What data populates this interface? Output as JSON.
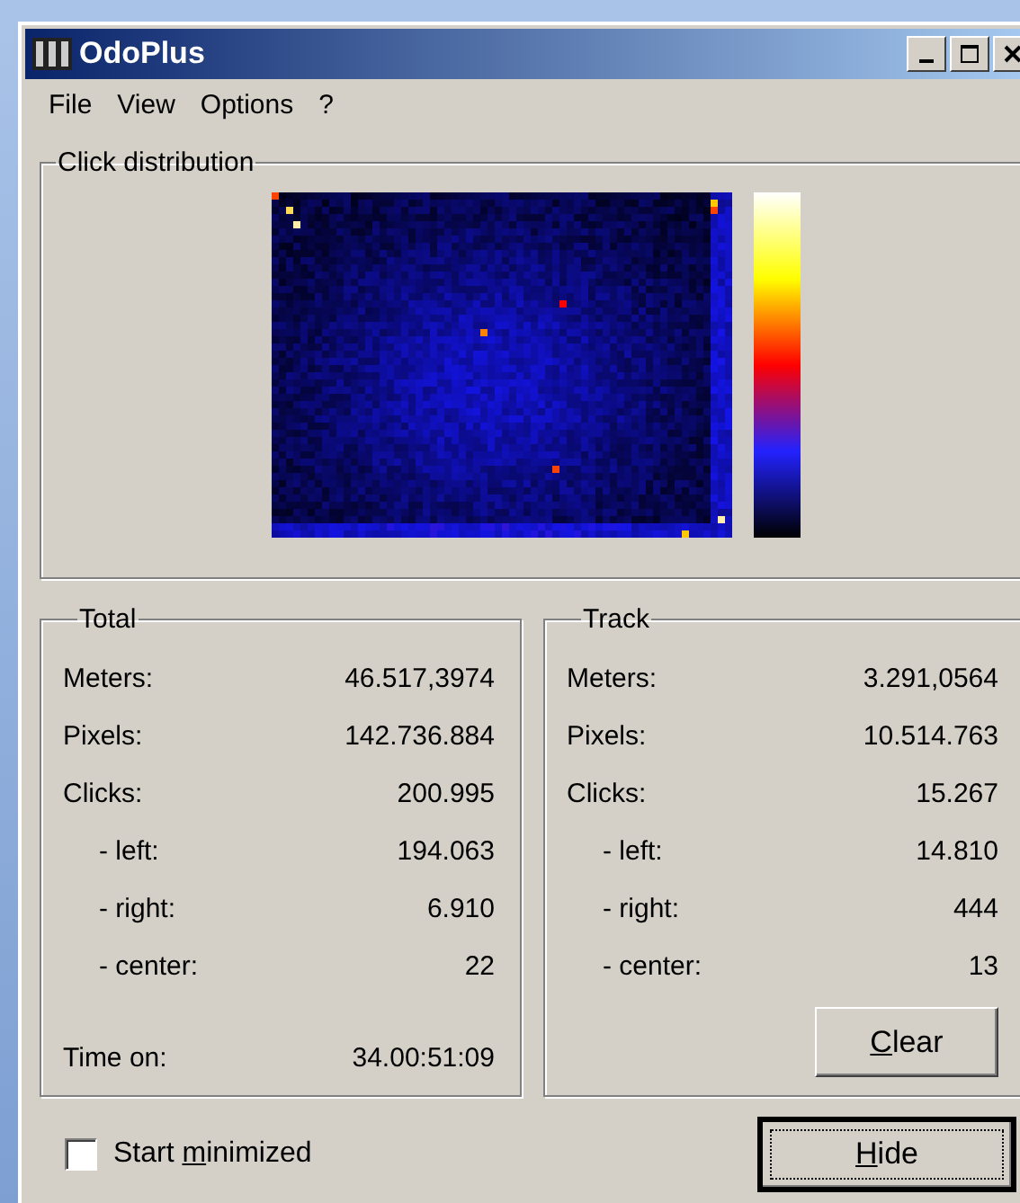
{
  "window": {
    "title": "OdoPlus"
  },
  "menu": [
    "File",
    "View",
    "Options",
    "?"
  ],
  "distribution": {
    "title": "Click distribution"
  },
  "total": {
    "title": "Total",
    "rows": [
      {
        "label": "Meters:",
        "value": "46.517,3974"
      },
      {
        "label": "Pixels:",
        "value": "142.736.884"
      },
      {
        "label": "Clicks:",
        "value": "200.995",
        "children": [
          {
            "label": "- left:",
            "value": "194.063"
          },
          {
            "label": "- right:",
            "value": "6.910"
          },
          {
            "label": "- center:",
            "value": "22"
          }
        ]
      }
    ],
    "footer": {
      "label": "Time on:",
      "value": "34.00:51:09"
    }
  },
  "track": {
    "title": "Track",
    "rows": [
      {
        "label": "Meters:",
        "value": "3.291,0564"
      },
      {
        "label": "Pixels:",
        "value": "10.514.763"
      },
      {
        "label": "Clicks:",
        "value": "15.267",
        "children": [
          {
            "label": "- left:",
            "value": "14.810"
          },
          {
            "label": "- right:",
            "value": "444"
          },
          {
            "label": "- center:",
            "value": "13"
          }
        ]
      }
    ],
    "button": {
      "key": "C",
      "after": "lear",
      "focused": false
    }
  },
  "start_minimized": {
    "before": "Start ",
    "key": "m",
    "after": "inimized",
    "checked": false
  },
  "hide_button": {
    "key": "H",
    "after": "ide",
    "focused": true
  }
}
